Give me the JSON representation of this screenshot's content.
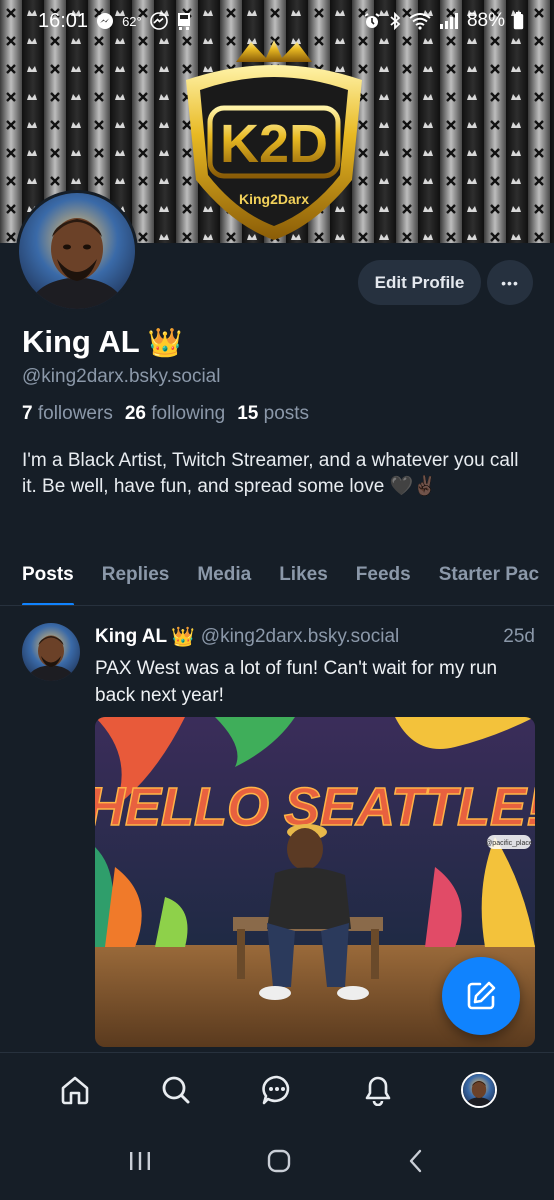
{
  "status_bar": {
    "time": "16:01",
    "temperature": "62°",
    "battery": "88%"
  },
  "banner": {
    "logo_text": "K2D",
    "logo_subtext": "King2Darx"
  },
  "profile": {
    "display_name": "King AL",
    "crown_emoji": "👑",
    "handle": "@king2darx.bsky.social",
    "followers_count": "7",
    "followers_label": "followers",
    "following_count": "26",
    "following_label": "following",
    "posts_count": "15",
    "posts_label": "posts",
    "bio": "I'm a Black Artist, Twitch Streamer, and a whatever you call it. Be well, have fun, and spread some love 🖤✌🏿",
    "edit_label": "Edit Profile",
    "more_label": "•••"
  },
  "tabs": [
    {
      "label": "Posts",
      "active": true
    },
    {
      "label": "Replies",
      "active": false
    },
    {
      "label": "Media",
      "active": false
    },
    {
      "label": "Likes",
      "active": false
    },
    {
      "label": "Feeds",
      "active": false
    },
    {
      "label": "Starter Pac",
      "active": false
    }
  ],
  "post": {
    "author": "King AL",
    "crown_emoji": "👑",
    "handle": "@king2darx.bsky.social",
    "time": "25d",
    "text": "PAX West was a lot of fun! Can't wait for my run back next year!",
    "image_text": "HELLO SEATTLE!",
    "image_tag": "@pacific_place"
  },
  "bottom_nav": {
    "items": [
      "home-icon",
      "search-icon",
      "chat-icon",
      "bell-icon",
      "profile-avatar"
    ]
  },
  "colors": {
    "background": "#161e27",
    "accent": "#1083fe",
    "muted": "#8b98a9",
    "button_bg": "#26313f"
  }
}
